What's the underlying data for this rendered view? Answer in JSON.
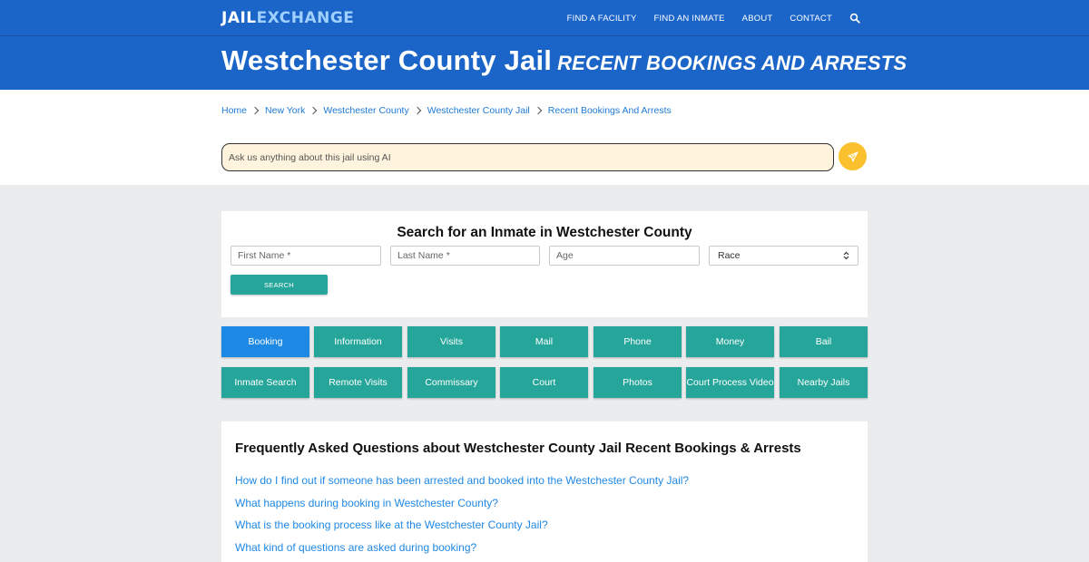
{
  "header": {
    "logo_part1": "JAIL",
    "logo_part2": "EXCHANGE",
    "nav": [
      "FIND A FACILITY",
      "FIND AN INMATE",
      "ABOUT",
      "CONTACT"
    ],
    "nav_search_icon": "search-icon"
  },
  "hero": {
    "title": "Westchester County Jail",
    "subtitle": "RECENT BOOKINGS AND ARRESTS"
  },
  "breadcrumb": [
    "Home",
    "New York",
    "Westchester County",
    "Westchester County Jail",
    "Recent Bookings And Arrests"
  ],
  "ai_search": {
    "placeholder": "Ask us anything about this jail using AI",
    "send_icon": "paper-plane-icon"
  },
  "inmate_search": {
    "title": "Search for an Inmate in Westchester County",
    "first_name_placeholder": "First Name *",
    "last_name_placeholder": "Last Name *",
    "age_placeholder": "Age",
    "race_selected": "Race",
    "button": "SEARCH"
  },
  "tiles": {
    "row1": [
      "Booking",
      "Information",
      "Visits",
      "Mail",
      "Phone",
      "Money",
      "Bail"
    ],
    "row2": [
      "Inmate Search",
      "Remote Visits",
      "Commissary",
      "Court",
      "Photos",
      "Court Process Video",
      "Nearby Jails"
    ],
    "active": "Booking"
  },
  "faq": {
    "title": "Frequently Asked Questions about Westchester County Jail Recent Bookings & Arrests",
    "questions": [
      "How do I find out if someone has been arrested and booked into the Westchester County Jail?",
      "What happens during booking in Westchester County?",
      "What is the booking process like at the Westchester County Jail?",
      "What kind of questions are asked during booking?"
    ]
  },
  "colors": {
    "header_blue": "#1b64c8",
    "teal": "#26a69a",
    "active_blue": "#1e88e5",
    "send_yellow": "#fbc02d",
    "ai_input_bg": "#fef4dd"
  }
}
